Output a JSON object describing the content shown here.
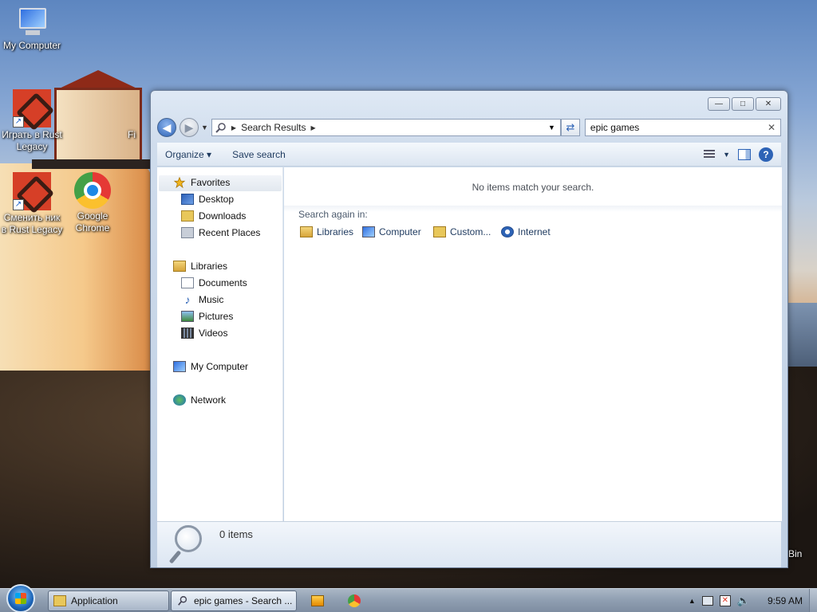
{
  "desktop": {
    "icons": [
      {
        "label": "My Computer"
      },
      {
        "label": "Играть в Rust Legacy"
      },
      {
        "label": "Сменить ник в Rust Legacy"
      },
      {
        "label": "Google Chrome"
      }
    ],
    "partial_labels": {
      "fi": "Fi",
      "bin": "Bin"
    }
  },
  "window": {
    "controls": {
      "minimize": "—",
      "maximize": "□",
      "close": "✕"
    },
    "address": {
      "location": "Search Results"
    },
    "search": {
      "value": "epic games"
    },
    "toolbar": {
      "organize": "Organize",
      "save_search": "Save search",
      "help": "?"
    },
    "nav": {
      "favorites": "Favorites",
      "desktop": "Desktop",
      "downloads": "Downloads",
      "recent_places": "Recent Places",
      "libraries": "Libraries",
      "documents": "Documents",
      "music": "Music",
      "pictures": "Pictures",
      "videos": "Videos",
      "my_computer": "My Computer",
      "network": "Network"
    },
    "content": {
      "no_match": "No items match your search.",
      "search_again": "Search again in:",
      "locations": [
        "Libraries",
        "Computer",
        "Custom...",
        "Internet"
      ]
    },
    "details": {
      "count": "0 items"
    }
  },
  "taskbar": {
    "tasks": [
      {
        "label": "Application"
      },
      {
        "label": "epic games - Search ..."
      }
    ],
    "clock": "9:59 AM"
  },
  "colors": {
    "accent": "#2d63b6",
    "window_bg": "#dfe9f5",
    "taskbar": "#8f9eb1"
  }
}
